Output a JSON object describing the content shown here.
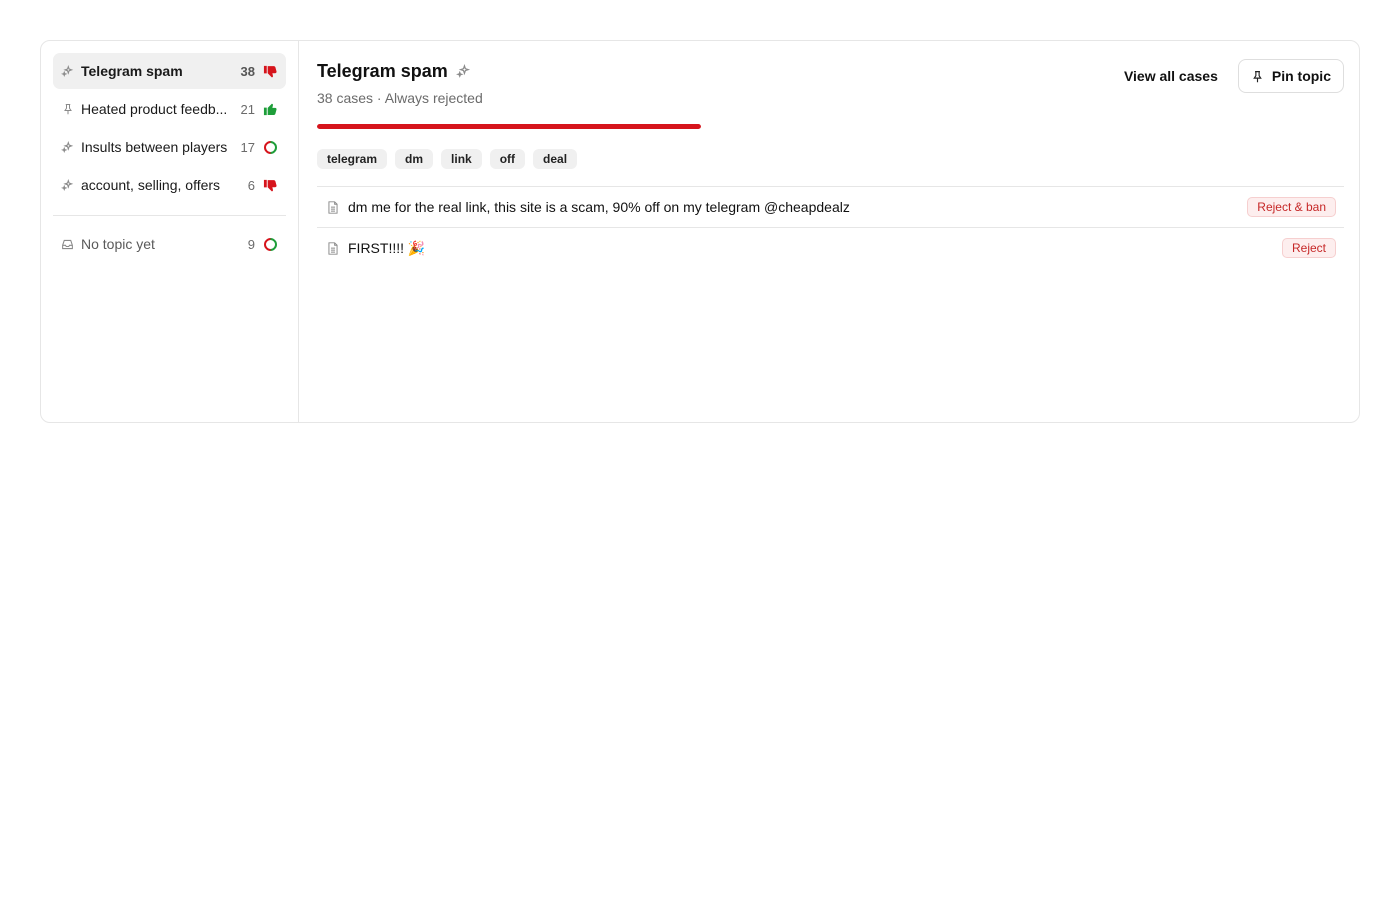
{
  "sidebar": {
    "items": [
      {
        "label": "Telegram spam",
        "count": "38",
        "icon": "sparkles-icon",
        "status": "thumbs-down",
        "active": true
      },
      {
        "label": "Heated product feedb...",
        "count": "21",
        "icon": "pin-icon",
        "status": "thumbs-up",
        "active": false
      },
      {
        "label": "Insults between players",
        "count": "17",
        "icon": "sparkles-icon",
        "status": "mixed",
        "active": false
      },
      {
        "label": "account, selling, offers",
        "count": "6",
        "icon": "sparkles-icon",
        "status": "thumbs-down",
        "active": false
      }
    ],
    "no_topic": {
      "label": "No topic yet",
      "count": "9",
      "icon": "inbox-icon",
      "status": "mixed"
    }
  },
  "topic": {
    "title": "Telegram spam",
    "subtitle": "38 cases · Always rejected",
    "reject_ratio": 1.0
  },
  "actions": {
    "view_all": "View all cases",
    "pin": "Pin topic"
  },
  "tags": [
    "telegram",
    "dm",
    "link",
    "off",
    "deal"
  ],
  "cases": [
    {
      "text": "dm me for the real link, this site is a scam, 90% off on my telegram @cheapdealz",
      "verdict": "Reject & ban"
    },
    {
      "text": "FIRST!!!! 🎉",
      "verdict": "Reject"
    }
  ],
  "colors": {
    "reject": "#d6141c",
    "approve": "#1e9e3a",
    "accent_bg": "#f0f0f0"
  }
}
